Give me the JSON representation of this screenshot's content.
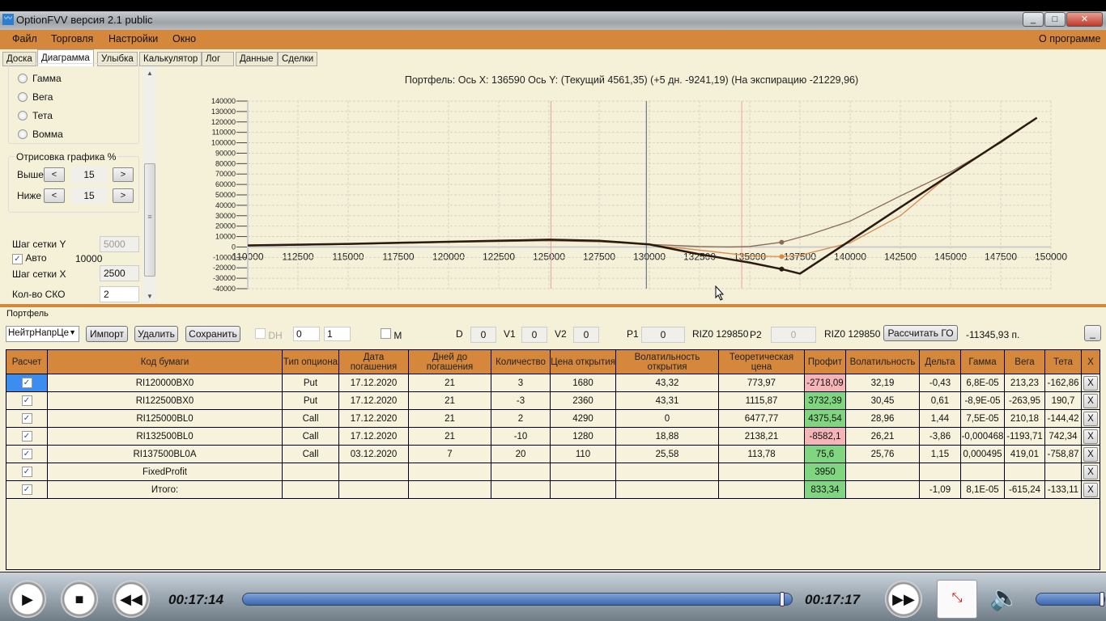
{
  "window": {
    "title": "OptionFVV версия 2.1 public",
    "minimize": "_",
    "maximize": "□",
    "close": "✕"
  },
  "menu": {
    "items": [
      "Файл",
      "Торговля",
      "Настройки",
      "Окно"
    ],
    "about": "О программе"
  },
  "tabs": [
    "Доска",
    "Диаграмма",
    "Улыбка",
    "Калькулятор",
    "Лог",
    "Данные",
    "Сделки"
  ],
  "left": {
    "radios": [
      "Гамма",
      "Вега",
      "Тета",
      "Вомма"
    ],
    "draw_group": "Отрисовка графика %",
    "above_label": "Выше",
    "above_value": "15",
    "below_label": "Ниже",
    "below_value": "15",
    "prev": "<",
    "next": ">",
    "grid_y_label": "Шаг сетки Y",
    "grid_y_value": "5000",
    "auto_label": "Авто",
    "auto_value": "10000",
    "grid_x_label": "Шаг сетки X",
    "grid_x_value": "2500",
    "sko_label": "Кол-во СКО",
    "sko_value": "2"
  },
  "chart_data": {
    "type": "line",
    "title": "Портфель: Ось X: 136590 Ось Y:  (Текущий 4561,35)  (+5 дн. -9241,19)  (На экспирацию -21229,96)",
    "xlim": [
      110000,
      150000
    ],
    "ylim": [
      -40000,
      140000
    ],
    "xticks": [
      "110000",
      "112500",
      "115000",
      "117500",
      "120000",
      "122500",
      "125000",
      "127500",
      "130000",
      "132500",
      "135000",
      "137500",
      "140000",
      "142500",
      "145000",
      "147500",
      "150000"
    ],
    "yticks": [
      "140000",
      "130000",
      "120000",
      "110000",
      "100000",
      "90000",
      "80000",
      "70000",
      "60000",
      "50000",
      "40000",
      "30000",
      "20000",
      "10000",
      "0",
      "-10000",
      "-20000",
      "-30000",
      "-40000"
    ],
    "grid": true,
    "vlines": [
      {
        "x": 125100,
        "color": "#f0a0a0"
      },
      {
        "x": 129850,
        "color": "#556070"
      },
      {
        "x": 134600,
        "color": "#f0a0a0"
      }
    ],
    "cursor_x": 136590,
    "series": [
      {
        "name": "Текущий",
        "color": "#8a6a55",
        "width": 1.3,
        "x": [
          110000,
          115000,
          120000,
          125000,
          127500,
          130000,
          132500,
          134000,
          135000,
          136590,
          138000,
          140000,
          142500,
          145000,
          147500,
          149300
        ],
        "y": [
          1000,
          2500,
          4500,
          6000,
          5000,
          2500,
          500,
          0,
          500,
          4561,
          12000,
          24800,
          49000,
          72000,
          100000,
          124000
        ]
      },
      {
        "name": "+5 дн.",
        "color": "#d88a4a",
        "width": 1.3,
        "x": [
          110000,
          115000,
          120000,
          125000,
          127500,
          130000,
          132500,
          135000,
          136590,
          137500,
          140000,
          142500,
          145000,
          147500,
          149300
        ],
        "y": [
          1200,
          3000,
          5000,
          6500,
          5500,
          2000,
          -3000,
          -8500,
          -9241,
          -8000,
          4000,
          30000,
          70000,
          101000,
          124000
        ]
      },
      {
        "name": "На экспирацию",
        "color": "#2a1a10",
        "width": 2.5,
        "x": [
          110000,
          115000,
          120000,
          125000,
          127500,
          130000,
          132500,
          135000,
          136590,
          137500,
          140000,
          142500,
          145000,
          147500,
          149300
        ],
        "y": [
          1500,
          3000,
          5000,
          7000,
          6000,
          2500,
          -7000,
          -15000,
          -21230,
          -25600,
          6100,
          38000,
          69600,
          101000,
          124000
        ]
      }
    ]
  },
  "portfolio": {
    "title": "Портфель",
    "strategy": "НейтрНапрЦе",
    "import": "Импорт",
    "delete": "Удалить",
    "save": "Сохранить",
    "dh_label": "DH",
    "spin1": "0",
    "spin2": "1",
    "m_label": "M",
    "d_label": "D",
    "d_value": "0",
    "v1_label": "V1",
    "v1_value": "0",
    "v2_label": "V2",
    "v2_value": "0",
    "p1_label": "P1",
    "p1_value": "0",
    "riz1": "RIZ0 129850",
    "p2_label": "P2",
    "p2_value": "0",
    "riz2": "RIZ0 129850",
    "calc_go": "Рассчитать ГО",
    "go_value": "-11345,93 п.",
    "collapse": "_"
  },
  "table": {
    "headers": [
      "Расчет",
      "Код бумаги",
      "Тип опциона",
      "Дата погашения",
      "Дней до погашения",
      "Количество",
      "Цена открытия",
      "Волатильность открытия",
      "Теоретическая цена",
      "Профит",
      "Волатильность",
      "Дельта",
      "Гамма",
      "Вега",
      "Тета",
      "X"
    ],
    "rows": [
      [
        "RI120000BX0",
        "Put",
        "17.12.2020",
        "21",
        "3",
        "1680",
        "43,32",
        "773,97",
        "-2718,09",
        "32,19",
        "-0,43",
        "6,8E-05",
        "213,23",
        "-162,86"
      ],
      [
        "RI122500BX0",
        "Put",
        "17.12.2020",
        "21",
        "-3",
        "2360",
        "43,31",
        "1115,87",
        "3732,39",
        "30,45",
        "0,61",
        "-8,9E-05",
        "-263,95",
        "190,7"
      ],
      [
        "RI125000BL0",
        "Call",
        "17.12.2020",
        "21",
        "2",
        "4290",
        "0",
        "6477,77",
        "4375,54",
        "28,96",
        "1,44",
        "7,5E-05",
        "210,18",
        "-144,42"
      ],
      [
        "RI132500BL0",
        "Call",
        "17.12.2020",
        "21",
        "-10",
        "1280",
        "18,88",
        "2138,21",
        "-8582,1",
        "26,21",
        "-3,86",
        "-0,000468",
        "-1193,71",
        "742,34"
      ],
      [
        "RI137500BL0A",
        "Call",
        "03.12.2020",
        "7",
        "20",
        "110",
        "25,58",
        "113,78",
        "75,6",
        "25,76",
        "1,15",
        "0,000495",
        "419,01",
        "-758,87"
      ],
      [
        "FixedProfit",
        "",
        "",
        "",
        "",
        "",
        "",
        "",
        "3950",
        "",
        "",
        "",
        "",
        ""
      ],
      [
        "Итого:",
        "",
        "",
        "",
        "",
        "",
        "",
        "",
        "833,34",
        "",
        "-1,09",
        "8,1E-05",
        "-615,24",
        "-133,11"
      ]
    ],
    "check": "✓",
    "remove": "X"
  },
  "player": {
    "elapsed": "00:17:14",
    "total": "00:17:17",
    "progress": 0.99,
    "volume": 0.97
  }
}
